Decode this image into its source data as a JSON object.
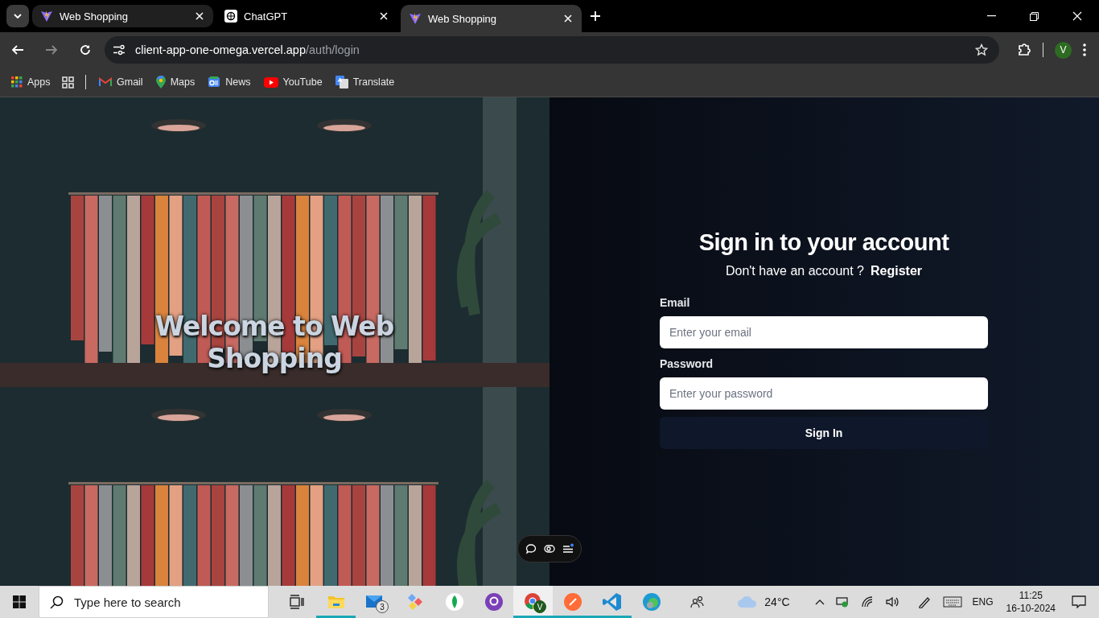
{
  "browser": {
    "tabs": [
      {
        "title": "Web Shopping",
        "kind": "vite",
        "selected": false
      },
      {
        "title": "ChatGPT",
        "kind": "chatgpt",
        "selected": false
      },
      {
        "title": "Web Shopping",
        "kind": "vite",
        "selected": true
      }
    ],
    "address": {
      "host": "client-app-one-omega.vercel.app",
      "path": "/auth/login"
    },
    "profile": "V",
    "bookmarks": [
      {
        "label": "Apps",
        "kind": "apps"
      },
      {
        "label": "Gmail",
        "kind": "gmail"
      },
      {
        "label": "Maps",
        "kind": "maps"
      },
      {
        "label": "News",
        "kind": "news"
      },
      {
        "label": "YouTube",
        "kind": "youtube"
      },
      {
        "label": "Translate",
        "kind": "translate"
      }
    ]
  },
  "hero": {
    "title": "Welcome to Web Shopping"
  },
  "login": {
    "title": "Sign in to your account",
    "prompt": "Don't have an account ?",
    "link": "Register",
    "fields": [
      {
        "label": "Email",
        "placeholder": "Enter your email"
      },
      {
        "label": "Password",
        "placeholder": "Enter your password"
      }
    ],
    "button": "Sign In"
  },
  "taskbar": {
    "search": {
      "placeholder": "Type here to search"
    },
    "apps": [
      {
        "kind": "taskview",
        "open": false,
        "selected": false
      },
      {
        "kind": "folder",
        "open": true,
        "selected": false
      },
      {
        "kind": "mail",
        "open": false,
        "selected": false,
        "badge": "3"
      },
      {
        "kind": "diamonds",
        "open": false,
        "selected": false
      },
      {
        "kind": "leaf",
        "open": false,
        "selected": false
      },
      {
        "kind": "github",
        "open": false,
        "selected": false
      },
      {
        "kind": "chrome",
        "open": true,
        "selected": true,
        "badge": "V"
      },
      {
        "kind": "postman",
        "open": true,
        "selected": false
      },
      {
        "kind": "vscode",
        "open": true,
        "selected": false
      },
      {
        "kind": "edge",
        "open": false,
        "selected": false
      }
    ],
    "weather": "24°C",
    "language": "ENG",
    "time": "11:25",
    "date": "16-10-2024"
  }
}
